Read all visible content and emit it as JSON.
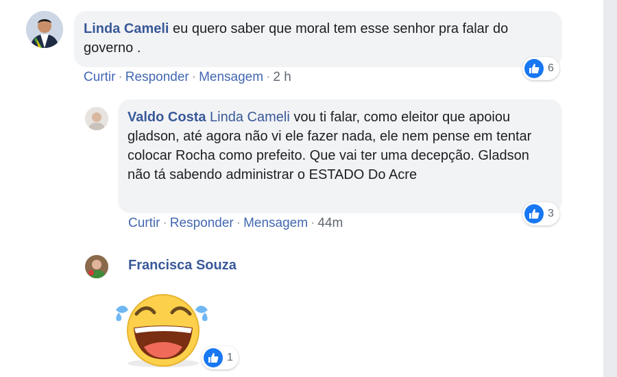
{
  "comments": [
    {
      "author": "Linda Cameli",
      "text": "eu quero saber que moral tem esse senhor pra falar do governo .",
      "actions": {
        "like": "Curtir",
        "reply": "Responder",
        "message": "Mensagem",
        "time": "2 h"
      },
      "reaction_count": "6"
    },
    {
      "author": "Valdo Costa",
      "mention": "Linda Cameli",
      "text": "vou ti falar, como eleitor que apoiou gladson, até agora não vi ele fazer nada, ele nem pense em tentar colocar Rocha como prefeito. Que vai ter uma decepção. Gladson não tá sabendo administrar o ESTADO Do Acre",
      "actions": {
        "like": "Curtir",
        "reply": "Responder",
        "message": "Mensagem",
        "time": "44m"
      },
      "reaction_count": "3"
    },
    {
      "author": "Francisca Souza",
      "sticker": "laughing-tears-emoji",
      "reaction_count": "1"
    }
  ],
  "separator": "·",
  "colors": {
    "link": "#385898",
    "action": "#4267b2",
    "bubble": "#f2f3f5",
    "like": "#1877f2"
  }
}
